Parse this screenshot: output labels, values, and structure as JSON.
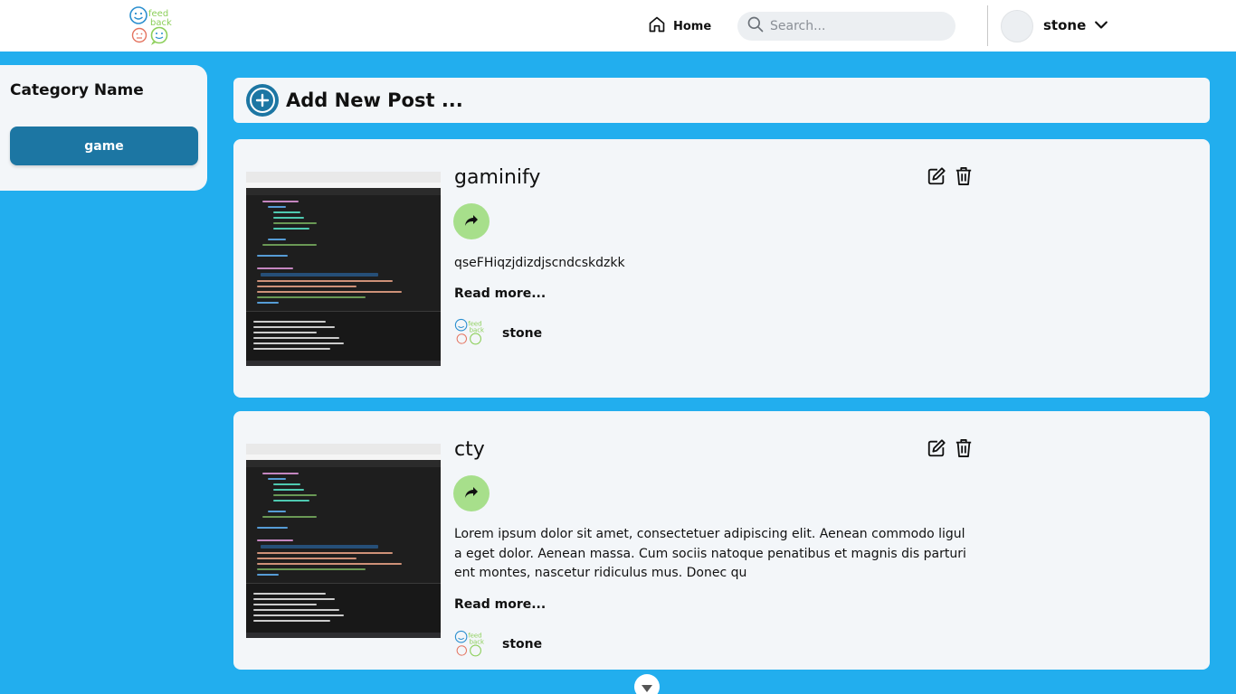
{
  "header": {
    "home_label": "Home",
    "search_placeholder": "Search...",
    "username": "stone"
  },
  "sidebar": {
    "title": "Category Name",
    "categories": [
      {
        "label": "game"
      }
    ]
  },
  "add_post": {
    "label": "Add New Post ..."
  },
  "posts": [
    {
      "title": "gaminify",
      "body": "qseFHiqzjdizdjscndcskdzkk",
      "read_more": "Read more...",
      "author": "stone"
    },
    {
      "title": "cty",
      "body": "Lorem ipsum dolor sit amet, consectetuer adipiscing elit. Aenean commodo ligula eget dolor. Aenean massa. Cum sociis natoque penatibus et magnis dis parturient montes, nascetur ridiculus mus. Donec qu",
      "read_more": "Read more...",
      "author": "stone"
    }
  ],
  "colors": {
    "background": "#22aeee",
    "card": "#f3f6f9",
    "primary": "#1c76a3",
    "share": "#a7df8b"
  },
  "icons": {
    "home": "home-icon",
    "search": "search-icon",
    "chevron": "chevron-down-icon",
    "add": "plus-circle-icon",
    "share": "share-icon",
    "edit": "edit-icon",
    "delete": "trash-icon",
    "scroll": "chevron-down-icon"
  }
}
